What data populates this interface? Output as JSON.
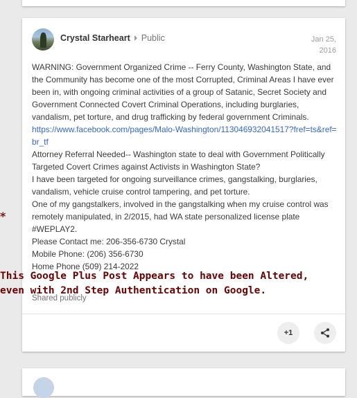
{
  "post": {
    "author": "Crystal Starheart",
    "visibility": "Public",
    "date_line1": "Jan 25,",
    "date_line2": "2016",
    "paragraphs": [
      "WARNING: Government Organized Crime -- Ferry County, Washington State, and the Community has become one of the most Corrupted, Criminal Areas I have ever been in, with ongoing criminal activities of a group of Satanic, Secret Society and Government Connected Covert Criminal Operations, including burglaries, vandalism, pet torture, and drug trafficking by federal government Criminals.",
      "https://www.facebook.com/pages/Malo-Washington/113046932041517?fref=ts&ref=br_tf",
      "Attorney Referral Needed-- Washington state to deal with Government Politically Targeted Covert Crimes against Activists in Washington State?",
      "I have been targeted for ongoing surveillance crimes, gangstalking, burglaries, vandalism, vehicle cruise control tampering, and pet torture.",
      "One of my gangstalkers, involved in the gangstalking when my cruise control was remotely manipulated, in 2/2015, had WA state personalized license plate #WEPLAY2.",
      "Please Contact me: 206-356-6730 Crystal",
      "Mobile Phone: (206) 356-6730",
      "Home Phone (509) 214-2022"
    ],
    "shared_label": "Shared publicly",
    "plus_one_label": "+1",
    "share_icon": "share-icon"
  },
  "annotation": {
    "asterisk": "*",
    "line1": "This Google Plus Post Appears to have been Altered,",
    "line2": "even with 2nd Step Authentication on Google.",
    "color": "#6b0000"
  },
  "colors": {
    "link": "#3367d6",
    "background": "#eaeaea"
  }
}
